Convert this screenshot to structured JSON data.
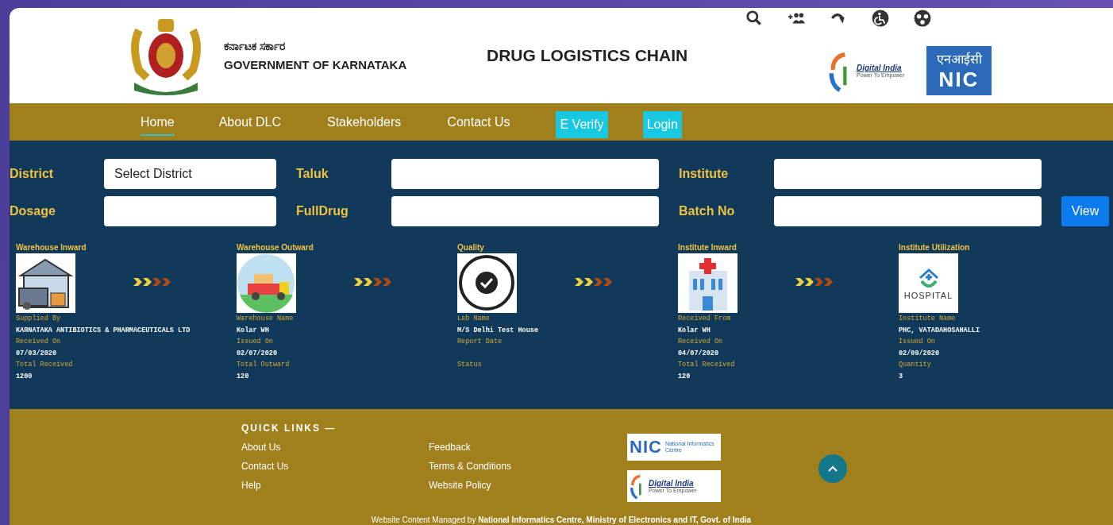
{
  "header": {
    "state_name_kannada": "ಕರ್ನಾಟಕ ಸರ್ಕಾರ",
    "state_name": "GOVERNMENT OF KARNATAKA",
    "title": "DRUG LOGISTICS CHAIN",
    "digital_india": {
      "name": "Digital India",
      "tagline": "Power To Empower"
    },
    "nic": {
      "hindi": "एनआईसी",
      "name": "NIC"
    }
  },
  "nav": [
    {
      "label": "Home",
      "kind": "link",
      "selected": true
    },
    {
      "label": "About DLC",
      "kind": "link",
      "selected": false
    },
    {
      "label": "Stakeholders",
      "kind": "link",
      "selected": false
    },
    {
      "label": "Contact Us",
      "kind": "link",
      "selected": false
    },
    {
      "label": "E Verify",
      "kind": "button",
      "selected": false
    },
    {
      "label": "Login",
      "kind": "button",
      "selected": false
    }
  ],
  "filters": [
    {
      "label": "District",
      "value": "Select District"
    },
    {
      "label": "Taluk"
    },
    {
      "label": "Institute"
    },
    {
      "label": "Dosage"
    },
    {
      "label": "FullDrug"
    },
    {
      "label": "Batch No"
    }
  ],
  "view_button": "View",
  "stages": [
    {
      "title": "Warehouse Inward",
      "kind": "warehouse",
      "fields": [
        {
          "label": "Supplied By",
          "value": "KARNATAKA ANTIBIOTICS & PHARMACEUTICALS LTD"
        },
        {
          "label": "Received On",
          "value": "07/03/2020"
        },
        {
          "label": "Total Received",
          "value": "1200"
        }
      ]
    },
    {
      "title": "Warehouse Outward",
      "kind": "truck",
      "fields": [
        {
          "label": "Warehouse Name",
          "value": "Kolar WH"
        },
        {
          "label": "Issued On",
          "value": "02/07/2020"
        },
        {
          "label": "Total Outward",
          "value": "120"
        }
      ]
    },
    {
      "title": "Quality",
      "kind": "quality",
      "fields": [
        {
          "label": "Lab Name",
          "value": "M/S Delhi Test House"
        },
        {
          "label": "Report Date"
        },
        {
          "label": "Status"
        }
      ]
    },
    {
      "title": "Institute Inward",
      "kind": "hospital",
      "fields": [
        {
          "label": "Received From",
          "value": "Kolar WH"
        },
        {
          "label": "Received On",
          "value": "04/07/2020"
        },
        {
          "label": "Total Received",
          "value": "120"
        }
      ]
    },
    {
      "title": "Institute Utilization",
      "kind": "hospital_logo",
      "logo_text": "HOSPITAL",
      "fields": [
        {
          "label": "Institute Name",
          "value": "PHC, VATADAHOSAHALLI"
        },
        {
          "label": "Issued On",
          "value": "02/09/2020"
        },
        {
          "label": "Quantity",
          "value": "3"
        }
      ]
    }
  ],
  "footer": {
    "quick_links_title": "QUICK LINKS —",
    "links": [
      [
        "About Us",
        "Contact Us",
        "Help"
      ],
      [
        "Feedback",
        "Terms & Conditions",
        "Website Policy"
      ]
    ],
    "nic_logo": {
      "name": "NIC",
      "subtitle": "National Informatics Centre"
    },
    "digital_india_logo": {
      "name": "Digital India",
      "tagline": "Power To Empower"
    },
    "credit": "Website Content Managed by **National Informatics Centre, Ministry of Electronics and IT, Govt. of India**"
  }
}
